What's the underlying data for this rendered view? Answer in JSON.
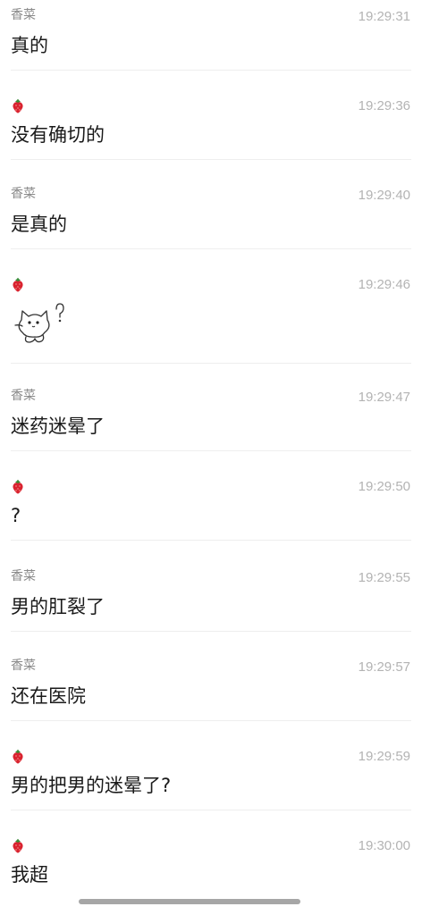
{
  "messages": [
    {
      "sender": "香菜",
      "time": "19:29:31",
      "text": "真的"
    },
    {
      "sender": "strawberry-avatar",
      "time": "19:29:36",
      "text": "没有确切的"
    },
    {
      "sender": "香菜",
      "time": "19:29:40",
      "text": "是真的"
    },
    {
      "sender": "strawberry-avatar",
      "time": "19:29:46",
      "sticker": "confused-cat-sticker"
    },
    {
      "sender": "香菜",
      "time": "19:29:47",
      "text": "迷药迷晕了"
    },
    {
      "sender": "strawberry-avatar",
      "time": "19:29:50",
      "text": "?"
    },
    {
      "sender": "香菜",
      "time": "19:29:55",
      "text": "男的肛裂了"
    },
    {
      "sender": "香菜",
      "time": "19:29:57",
      "text": "还在医院"
    },
    {
      "sender": "strawberry-avatar",
      "time": "19:29:59",
      "text": "男的把男的迷晕了?"
    },
    {
      "sender": "strawberry-avatar",
      "time": "19:30:00",
      "text": "我超"
    }
  ],
  "colors": {
    "sender": "#8a8a8a",
    "time": "#b3b3b3",
    "text": "#1a1a1a",
    "divider": "#eeeeee",
    "strawberry": "#d9232f"
  }
}
